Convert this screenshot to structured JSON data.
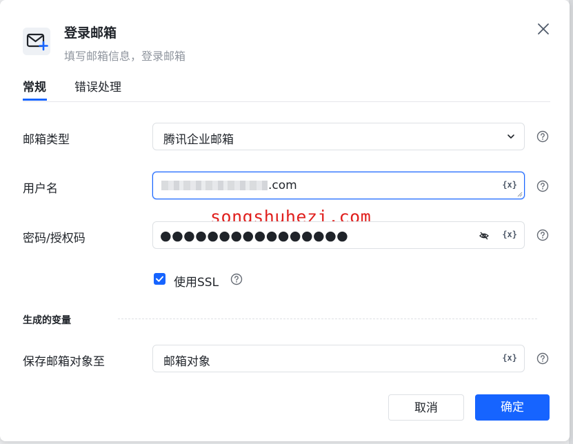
{
  "dialog": {
    "title": "登录邮箱",
    "subtitle": "填写邮箱信息，登录邮箱",
    "header_icon": "mail-plus-icon",
    "close_icon": "close-icon"
  },
  "tabs": [
    {
      "label": "常规",
      "active": true
    },
    {
      "label": "错误处理",
      "active": false
    }
  ],
  "form": {
    "mailbox_type": {
      "label": "邮箱类型",
      "value": "腾讯企业邮箱"
    },
    "username": {
      "label": "用户名",
      "value_suffix": ".com",
      "fx": "{x}"
    },
    "password": {
      "label": "密码/授权码",
      "value": "●●●●●●●●●●●●●●●●",
      "fx": "{x}"
    },
    "use_ssl": {
      "label": "使用SSL",
      "checked": true
    },
    "section": {
      "label": "生成的变量"
    },
    "save_to": {
      "label": "保存邮箱对象至",
      "value": "邮箱对象",
      "fx": "{x}"
    }
  },
  "buttons": {
    "cancel": "取消",
    "confirm": "确定"
  },
  "watermark": "songshuhezi.com",
  "colors": {
    "primary": "#1664ff",
    "watermark": "#e0201e"
  }
}
